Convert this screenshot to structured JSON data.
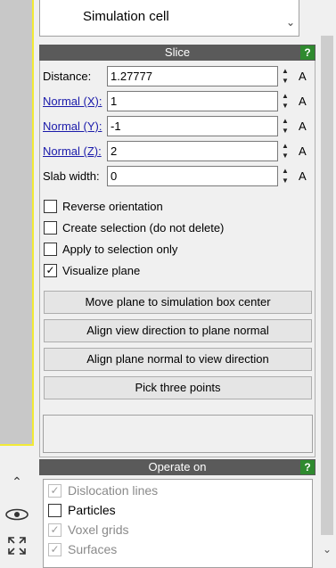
{
  "pipeline_list": {
    "item": "Simulation cell"
  },
  "slice": {
    "title": "Slice",
    "help": "?",
    "fields": [
      {
        "label": "Distance:",
        "value": "1.27777",
        "unit": "A",
        "link": false
      },
      {
        "label": "Normal (X):",
        "value": "1",
        "unit": "A",
        "link": true
      },
      {
        "label": "Normal (Y):",
        "value": "-1",
        "unit": "A",
        "link": true
      },
      {
        "label": "Normal (Z):",
        "value": "2",
        "unit": "A",
        "link": true
      },
      {
        "label": "Slab width:",
        "value": "0",
        "unit": "A",
        "link": false
      }
    ],
    "checkboxes": [
      {
        "label": "Reverse orientation",
        "checked": false
      },
      {
        "label": "Create selection (do not delete)",
        "checked": false
      },
      {
        "label": "Apply to selection only",
        "checked": false
      },
      {
        "label": "Visualize plane",
        "checked": true
      }
    ],
    "buttons": [
      "Move plane to simulation box center",
      "Align view direction to plane normal",
      "Align plane normal to view direction",
      "Pick three points"
    ]
  },
  "operate_on": {
    "title": "Operate on",
    "help": "?",
    "items": [
      {
        "label": "Dislocation lines",
        "checked": true,
        "enabled": false
      },
      {
        "label": "Particles",
        "checked": false,
        "enabled": true
      },
      {
        "label": "Voxel grids",
        "checked": true,
        "enabled": false
      },
      {
        "label": "Surfaces",
        "checked": true,
        "enabled": false
      }
    ]
  },
  "icons": {
    "check": "✓",
    "chevron_up": "^",
    "chevron_down": "v"
  }
}
